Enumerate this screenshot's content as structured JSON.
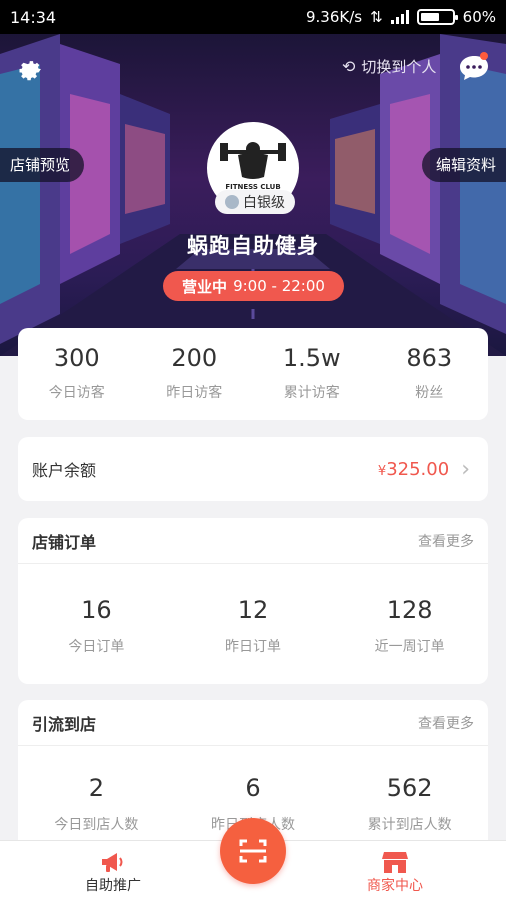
{
  "status_bar": {
    "time": "14:34",
    "network_speed": "9.36K/s",
    "battery": "60%",
    "battery_level": 0.6
  },
  "header": {
    "switch_label": "切换到个人",
    "store_preview": "店铺预览",
    "edit_profile": "编辑资料",
    "badge": "白银级",
    "shop_name": "蜗跑自助健身",
    "status_label": "营业中",
    "hours": "9:00 - 22:00",
    "logo_text": "FITNESS CLUB"
  },
  "stats": [
    {
      "value": "300",
      "label": "今日访客"
    },
    {
      "value": "200",
      "label": "昨日访客"
    },
    {
      "value": "1.5w",
      "label": "累计访客"
    },
    {
      "value": "863",
      "label": "粉丝"
    }
  ],
  "balance": {
    "label": "账户余额",
    "currency": "¥",
    "amount": "325.00"
  },
  "orders": {
    "title": "店铺订单",
    "more": "查看更多",
    "items": [
      {
        "value": "16",
        "label": "今日订单"
      },
      {
        "value": "12",
        "label": "昨日订单"
      },
      {
        "value": "128",
        "label": "近一周订单"
      }
    ]
  },
  "traffic": {
    "title": "引流到店",
    "more": "查看更多",
    "items": [
      {
        "value": "2",
        "label": "今日到店人数"
      },
      {
        "value": "6",
        "label": "昨日到店人数"
      },
      {
        "value": "562",
        "label": "累计到店人数"
      }
    ]
  },
  "bottom_nav": {
    "left": "自助推广",
    "right": "商家中心"
  },
  "colors": {
    "accent": "#f0584e",
    "hero_bg": "#2b1c55"
  }
}
